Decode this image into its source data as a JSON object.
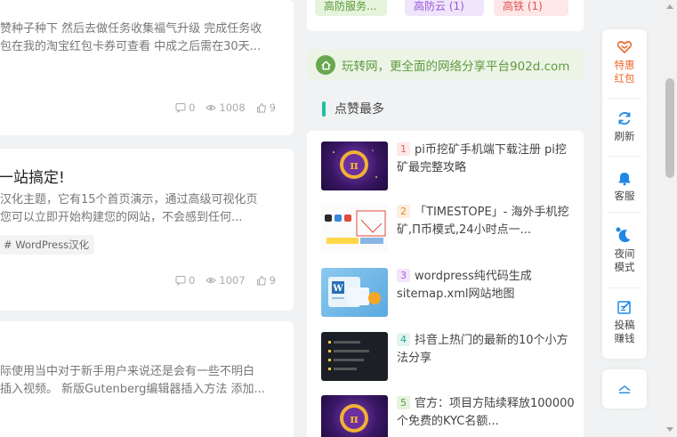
{
  "articles": [
    {
      "title": "",
      "excerpt": [
        "赞种子种下 然后去做任务收集福气升级 完成任务收",
        "包在我的淘宝红包卡券可查看 中成之后需在30天..."
      ],
      "comments": "0",
      "views": "1008",
      "likes": "9"
    },
    {
      "title": "一站搞定!",
      "excerpt": [
        "汉化主题，它有15个首页演示，通过高级可视化页",
        "您可以立即开始构建您的网站，不会感到任何..."
      ],
      "tag": "# WordPress汉化",
      "comments": "0",
      "views": "1007",
      "likes": "9"
    },
    {
      "title": "",
      "excerpt": [
        "际使用当中对于新手用户来说还是会有一些不明白",
        "插入视频。 新版Gutenberg编辑器插入方法 添加..."
      ]
    }
  ],
  "tag_chips": [
    {
      "label": "高防服务...",
      "bg": "#e6f3dd",
      "color": "#5b9a3a"
    },
    {
      "label": "高防云 (1)",
      "bg": "#f0e6fb",
      "color": "#9a55d6"
    },
    {
      "label": "高铁 (1)",
      "bg": "#fde7e7",
      "color": "#e05555"
    }
  ],
  "banner": {
    "text": "玩转网，更全面的网络分享平台902d.com",
    "icon": "home-icon"
  },
  "section": {
    "title": "点赞最多"
  },
  "top_liked": [
    {
      "rank": "1",
      "title": "pi币挖矿手机端下载注册 pi挖矿最完整攻略",
      "rank_bg": "#fde8e8",
      "rank_color": "#e56060"
    },
    {
      "rank": "2",
      "title": "「TIMESTOPE」- 海外手机挖矿,Π币模式,24小时点一...",
      "rank_bg": "#fdeede",
      "rank_color": "#e58a3a"
    },
    {
      "rank": "3",
      "title": "wordpress纯代码生成sitemap.xml网站地图",
      "rank_bg": "#f3e6fb",
      "rank_color": "#b45ad8"
    },
    {
      "rank": "4",
      "title": "抖音上热门的最新的10个小方法分享",
      "rank_bg": "#e3f5f1",
      "rank_color": "#2ba88a"
    },
    {
      "rank": "5",
      "title": "官方：项目方陆续释放100000个免费的KYC名额...",
      "rank_bg": "#e6f3dd",
      "rank_color": "#5b9a3a"
    }
  ],
  "rail": [
    {
      "label_1": "特惠",
      "label_2": "红包",
      "icon": "heart-icon",
      "color": "#f06a2c"
    },
    {
      "label_1": "刷新",
      "label_2": "",
      "icon": "refresh-icon",
      "color": "#1e88e5"
    },
    {
      "label_1": "客服",
      "label_2": "",
      "icon": "bell-icon",
      "color": "#1e88e5"
    },
    {
      "label_1": "夜间",
      "label_2": "模式",
      "icon": "moon-icon",
      "color": "#1e88e5"
    },
    {
      "label_1": "投稿",
      "label_2": "赚钱",
      "icon": "edit-icon",
      "color": "#1e88e5"
    }
  ],
  "back_to_top": {
    "icon": "chevron-up-icon"
  }
}
